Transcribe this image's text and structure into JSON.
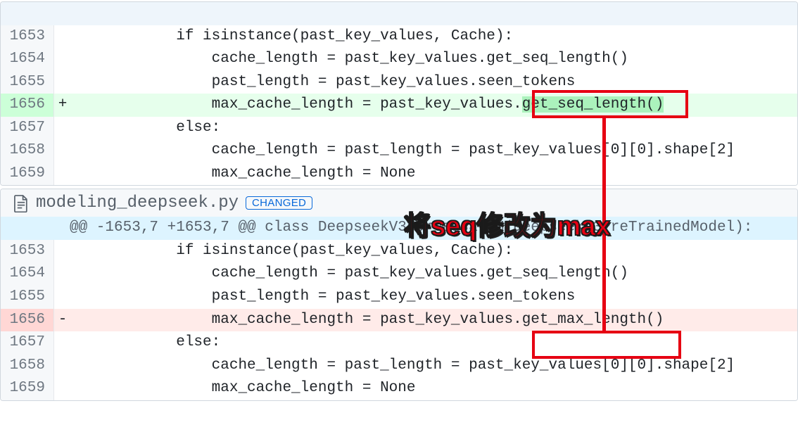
{
  "panel_top": {
    "rows": [
      {
        "n": "1653",
        "sign": "",
        "code": "            if isinstance(past_key_values, Cache):",
        "cls": ""
      },
      {
        "n": "1654",
        "sign": "",
        "code": "                cache_length = past_key_values.get_seq_length()",
        "cls": ""
      },
      {
        "n": "1655",
        "sign": "",
        "code": "                past_length = past_key_values.seen_tokens",
        "cls": ""
      },
      {
        "n": "1656",
        "sign": "+",
        "code": "                max_cache_length = past_key_values.",
        "cls": "add",
        "tail_hi": "get_seq_length()"
      },
      {
        "n": "1657",
        "sign": "",
        "code": "            else:",
        "cls": ""
      },
      {
        "n": "1658",
        "sign": "",
        "code": "                cache_length = past_length = past_key_values[0][0].shape[2]",
        "cls": ""
      },
      {
        "n": "1659",
        "sign": "",
        "code": "                max_cache_length = None",
        "cls": ""
      }
    ]
  },
  "panel_bottom": {
    "filename": "modeling_deepseek.py",
    "badge": "CHANGED",
    "hunk": "@@ -1653,7 +1653,7 @@ class DeepseekV3ForCausalLM(DeepseekV3PreTrainedModel):",
    "rows": [
      {
        "n": "1653",
        "sign": "",
        "code": "            if isinstance(past_key_values, Cache):",
        "cls": ""
      },
      {
        "n": "1654",
        "sign": "",
        "code": "                cache_length = past_key_values.get_seq_length()",
        "cls": ""
      },
      {
        "n": "1655",
        "sign": "",
        "code": "                past_length = past_key_values.seen_tokens",
        "cls": ""
      },
      {
        "n": "1656",
        "sign": "-",
        "code": "                max_cache_length = past_key_values.get_max_length()",
        "cls": "del"
      },
      {
        "n": "1657",
        "sign": "",
        "code": "            else:",
        "cls": ""
      },
      {
        "n": "1658",
        "sign": "",
        "code": "                cache_length = past_length = past_key_values[0][0].shape[2]",
        "cls": ""
      },
      {
        "n": "1659",
        "sign": "",
        "code": "                max_cache_length = None",
        "cls": ""
      }
    ]
  },
  "annotation": {
    "text": "将seq修改为max"
  }
}
